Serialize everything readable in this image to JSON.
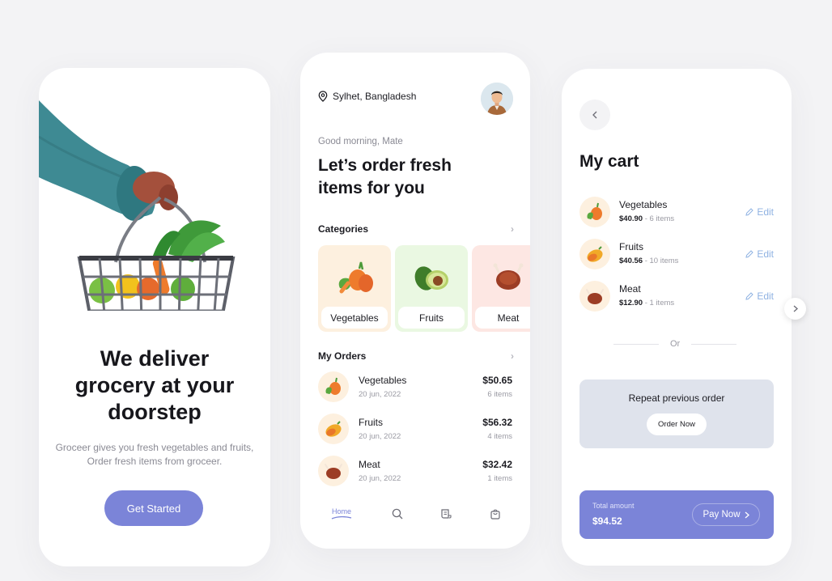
{
  "onboarding": {
    "title_line1": "We deliver",
    "title_line2": "grocery at your",
    "title_line3": "doorstep",
    "subtitle_line1": "Groceer gives you fresh vegetables and fruits,",
    "subtitle_line2": "Order fresh items from groceer.",
    "cta_label": "Get Started"
  },
  "home": {
    "location": "Sylhet, Bangladesh",
    "greeting": "Good morning, Mate",
    "headline_line1": "Let’s order fresh",
    "headline_line2": "items for you",
    "categories_heading": "Categories",
    "categories": [
      {
        "label": "Vegetables",
        "icon": "vegetables-icon",
        "bg": "#fdf0df"
      },
      {
        "label": "Fruits",
        "icon": "avocado-icon",
        "bg": "#eaf8e2"
      },
      {
        "label": "Meat",
        "icon": "chicken-icon",
        "bg": "#fde7e3"
      }
    ],
    "orders_heading": "My Orders",
    "orders": [
      {
        "name": "Vegetables",
        "date": "20 jun, 2022",
        "price": "$50.65",
        "qty": "6 items"
      },
      {
        "name": "Fruits",
        "date": "20 jun, 2022",
        "price": "$56.32",
        "qty": "4 items"
      },
      {
        "name": "Meat",
        "date": "20 jun, 2022",
        "price": "$32.42",
        "qty": "1 items"
      }
    ],
    "nav": {
      "home_label": "Home"
    }
  },
  "cart": {
    "title": "My cart",
    "items": [
      {
        "name": "Vegetables",
        "price": "$40.90",
        "qty": "6 items",
        "edit": "Edit"
      },
      {
        "name": "Fruits",
        "price": "$40.56",
        "qty": "10 items",
        "edit": "Edit"
      },
      {
        "name": "Meat",
        "price": "$12.90",
        "qty": "1 items",
        "edit": "Edit"
      }
    ],
    "or_label": "Or",
    "repeat_title": "Repeat previous order",
    "order_now_label": "Order Now",
    "total_label": "Total amount",
    "total_value": "$94.52",
    "pay_label": "Pay Now"
  },
  "colors": {
    "accent": "#7b84d8",
    "edit_link": "#8fb2e2",
    "repeat_box": "#dfe3ec"
  }
}
